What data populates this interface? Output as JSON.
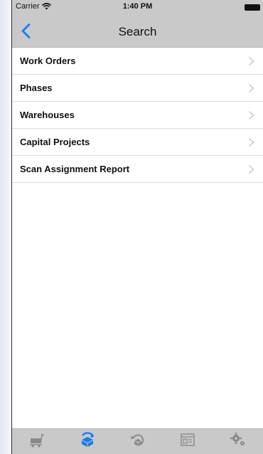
{
  "status_bar": {
    "carrier": "Carrier",
    "time": "1:40 PM"
  },
  "nav": {
    "title": "Search",
    "back_icon": "chevron-left-icon"
  },
  "list": {
    "items": [
      {
        "label": "Work Orders"
      },
      {
        "label": "Phases"
      },
      {
        "label": "Warehouses"
      },
      {
        "label": "Capital Projects"
      },
      {
        "label": "Scan Assignment Report"
      }
    ]
  },
  "tab_bar": {
    "tabs": [
      {
        "icon": "cart-icon",
        "selected": false
      },
      {
        "icon": "box-refresh-icon",
        "selected": true
      },
      {
        "icon": "box-return-icon",
        "selected": false
      },
      {
        "icon": "report-icon",
        "selected": false
      },
      {
        "icon": "gears-icon",
        "selected": false
      }
    ]
  },
  "colors": {
    "accent": "#1a7cf0",
    "bar_gray": "#c9c9c9",
    "icon_gray": "#8a8a8a"
  }
}
